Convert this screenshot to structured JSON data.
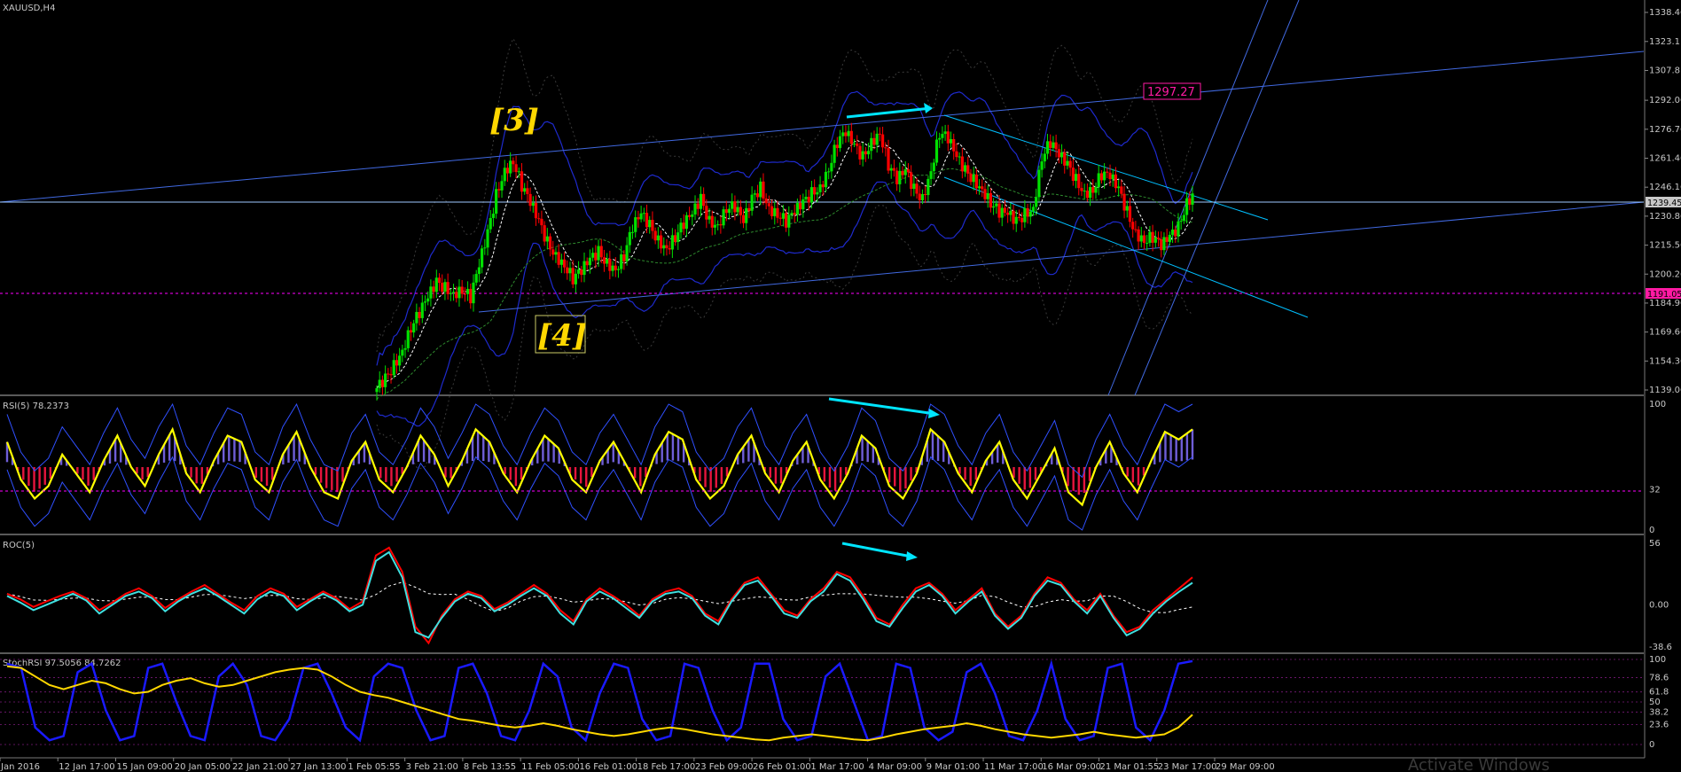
{
  "window": {
    "symbol_label": "XAUUSD,H4",
    "watermark": "Activate Windows"
  },
  "colors": {
    "background": "#000000",
    "bull_candle": "#00e000",
    "bear_candle": "#ff0000",
    "trendline_blue": "#4169e1",
    "trendline_cyan": "#00bfff",
    "ma_dotted": "#ffffff",
    "ma_green_dotted": "#2e8b2e",
    "bollinger": "#1e2acd",
    "wave_label": "#ffd700",
    "price_tag_magenta": "#ff1aa3",
    "rsi_line": "#ffff00",
    "hist_pos": "#7b68ee",
    "hist_neg": "#ff1744",
    "roc_cyan": "#40e0e0",
    "roc_red": "#ff0000",
    "stoch_blue": "#1a1aff",
    "stoch_yellow": "#ffd700"
  },
  "annotations": {
    "wave3": "[3]",
    "wave4": "[4]",
    "price_tag_upper": "1297.27",
    "price_tag_lower": "1191.05",
    "price_tag_current": "1239.45"
  },
  "chart_data": [
    {
      "type": "candlestick",
      "title": "XAUUSD,H4",
      "y_ticks": [
        "1338.46",
        "1323.11",
        "1307.81",
        "1292.06",
        "1276.76",
        "1261.46",
        "1246.16",
        "1230.86",
        "1215.56",
        "1200.26",
        "1184.96",
        "1169.66",
        "1154.36",
        "1139.06"
      ],
      "ylim": [
        1139.06,
        1338.46
      ],
      "current_price": 1239.45,
      "horizontal_lines": [
        1239.45,
        1191.05
      ],
      "x_ticks": [
        "Jan 2016",
        "12 Jan 17:00",
        "15 Jan 09:00",
        "20 Jan 05:00",
        "22 Jan 21:00",
        "27 Jan 13:00",
        "1 Feb 05:55",
        "3 Feb 21:00",
        "8 Feb 13:55",
        "11 Feb 05:00",
        "16 Feb 01:00",
        "18 Feb 17:00",
        "23 Feb 09:00",
        "26 Feb 01:00",
        "1 Mar 17:00",
        "4 Mar 09:00",
        "9 Mar 01:00",
        "11 Mar 17:00",
        "16 Mar 09:00",
        "21 Mar 01:55",
        "23 Mar 17:00",
        "29 Mar 09:00"
      ],
      "close_path": [
        1140,
        1145,
        1152,
        1160,
        1172,
        1180,
        1188,
        1196,
        1193,
        1190,
        1192,
        1188,
        1205,
        1222,
        1242,
        1255,
        1260,
        1247,
        1238,
        1228,
        1217,
        1210,
        1205,
        1198,
        1202,
        1208,
        1212,
        1206,
        1203,
        1210,
        1225,
        1232,
        1226,
        1218,
        1214,
        1220,
        1227,
        1232,
        1240,
        1228,
        1226,
        1235,
        1236,
        1228,
        1240,
        1246,
        1235,
        1232,
        1228,
        1233,
        1238,
        1243,
        1246,
        1256,
        1270,
        1275,
        1268,
        1262,
        1270,
        1275,
        1258,
        1250,
        1255,
        1245,
        1240,
        1255,
        1275,
        1272,
        1262,
        1255,
        1250,
        1245,
        1238,
        1233,
        1232,
        1228,
        1232,
        1235,
        1262,
        1270,
        1263,
        1258,
        1250,
        1243,
        1245,
        1253,
        1252,
        1245,
        1233,
        1222,
        1218,
        1220,
        1215,
        1220,
        1225,
        1238,
        1244
      ]
    },
    {
      "type": "line",
      "title": "RSI(5) 78.2373",
      "y_ticks": [
        "100",
        "32",
        "0"
      ],
      "ylim": [
        0,
        100
      ],
      "last_value": 78.2373,
      "series": [
        {
          "values": [
            70,
            40,
            25,
            35,
            60,
            45,
            30,
            55,
            75,
            50,
            35,
            60,
            80,
            45,
            30,
            55,
            75,
            70,
            40,
            30,
            60,
            78,
            50,
            30,
            25,
            55,
            70,
            40,
            30,
            50,
            75,
            60,
            35,
            55,
            80,
            70,
            45,
            30,
            55,
            75,
            65,
            40,
            30,
            55,
            70,
            50,
            30,
            60,
            78,
            72,
            40,
            25,
            35,
            60,
            75,
            45,
            30,
            55,
            70,
            40,
            25,
            45,
            75,
            65,
            35,
            25,
            45,
            80,
            70,
            45,
            30,
            55,
            70,
            40,
            25,
            45,
            65,
            30,
            20,
            50,
            70,
            45,
            30,
            55,
            78,
            72,
            80
          ]
        }
      ]
    },
    {
      "type": "line",
      "title": "ROC(5)",
      "y_ticks": [
        "56",
        "0.00",
        "-38.6"
      ],
      "ylim": [
        -38.6,
        56
      ],
      "series": [
        {
          "name": "",
          "values": [
            10,
            5,
            -2,
            3,
            8,
            12,
            6,
            -5,
            2,
            10,
            15,
            8,
            -3,
            5,
            12,
            18,
            10,
            2,
            -5,
            8,
            15,
            10,
            -2,
            5,
            12,
            6,
            -4,
            3,
            45,
            52,
            30,
            -20,
            -35,
            -10,
            5,
            12,
            8,
            -4,
            2,
            10,
            18,
            10,
            -5,
            -15,
            5,
            15,
            8,
            0,
            -10,
            5,
            12,
            15,
            8,
            -8,
            -15,
            5,
            20,
            25,
            10,
            -5,
            -10,
            5,
            15,
            30,
            25,
            8,
            -12,
            -18,
            0,
            15,
            20,
            10,
            -5,
            5,
            15,
            -8,
            -20,
            -10,
            10,
            25,
            20,
            5,
            -5,
            10,
            -10,
            -25,
            -20,
            -5,
            5,
            15,
            25
          ]
        },
        {
          "name": "",
          "values": [
            8,
            2,
            -5,
            0,
            5,
            10,
            4,
            -8,
            0,
            8,
            12,
            6,
            -6,
            3,
            10,
            15,
            8,
            0,
            -8,
            5,
            12,
            8,
            -5,
            3,
            10,
            4,
            -6,
            0,
            40,
            48,
            25,
            -25,
            -30,
            -12,
            3,
            10,
            6,
            -6,
            0,
            8,
            15,
            8,
            -8,
            -18,
            3,
            12,
            6,
            -3,
            -12,
            3,
            10,
            12,
            6,
            -10,
            -18,
            3,
            18,
            22,
            8,
            -8,
            -12,
            3,
            12,
            28,
            22,
            5,
            -15,
            -20,
            -3,
            12,
            18,
            8,
            -8,
            3,
            12,
            -10,
            -22,
            -12,
            8,
            22,
            18,
            3,
            -8,
            8,
            -12,
            -28,
            -22,
            -8,
            3,
            12,
            20
          ]
        }
      ]
    },
    {
      "type": "line",
      "title": "StochRSI 97.5056 84.7262",
      "y_ticks": [
        "100",
        "78.6",
        "61.8",
        "50",
        "38.2",
        "23.6",
        "0"
      ],
      "ylim": [
        0,
        100
      ],
      "series": [
        {
          "values": [
            95,
            90,
            20,
            5,
            10,
            85,
            95,
            40,
            5,
            10,
            90,
            95,
            50,
            10,
            5,
            80,
            95,
            70,
            10,
            5,
            30,
            90,
            95,
            60,
            20,
            5,
            80,
            95,
            90,
            40,
            5,
            10,
            90,
            95,
            60,
            10,
            5,
            40,
            95,
            80,
            20,
            5,
            60,
            95,
            90,
            30,
            5,
            10,
            95,
            90,
            40,
            5,
            20,
            95,
            95,
            30,
            5,
            10,
            80,
            95,
            50,
            5,
            10,
            95,
            90,
            20,
            5,
            15,
            85,
            95,
            60,
            10,
            5,
            40,
            95,
            30,
            5,
            10,
            90,
            95,
            20,
            5,
            40,
            95,
            98
          ]
        },
        {
          "values": [
            92,
            90,
            80,
            70,
            65,
            70,
            75,
            72,
            65,
            60,
            62,
            70,
            75,
            78,
            72,
            68,
            70,
            75,
            80,
            85,
            88,
            90,
            88,
            80,
            70,
            62,
            58,
            55,
            50,
            45,
            40,
            35,
            30,
            28,
            25,
            22,
            20,
            22,
            25,
            22,
            18,
            15,
            12,
            10,
            12,
            15,
            18,
            20,
            18,
            15,
            12,
            10,
            8,
            6,
            5,
            8,
            10,
            12,
            10,
            8,
            6,
            5,
            8,
            12,
            15,
            18,
            20,
            22,
            25,
            22,
            18,
            15,
            12,
            10,
            8,
            10,
            12,
            15,
            12,
            10,
            8,
            10,
            12,
            20,
            35
          ]
        }
      ]
    }
  ]
}
